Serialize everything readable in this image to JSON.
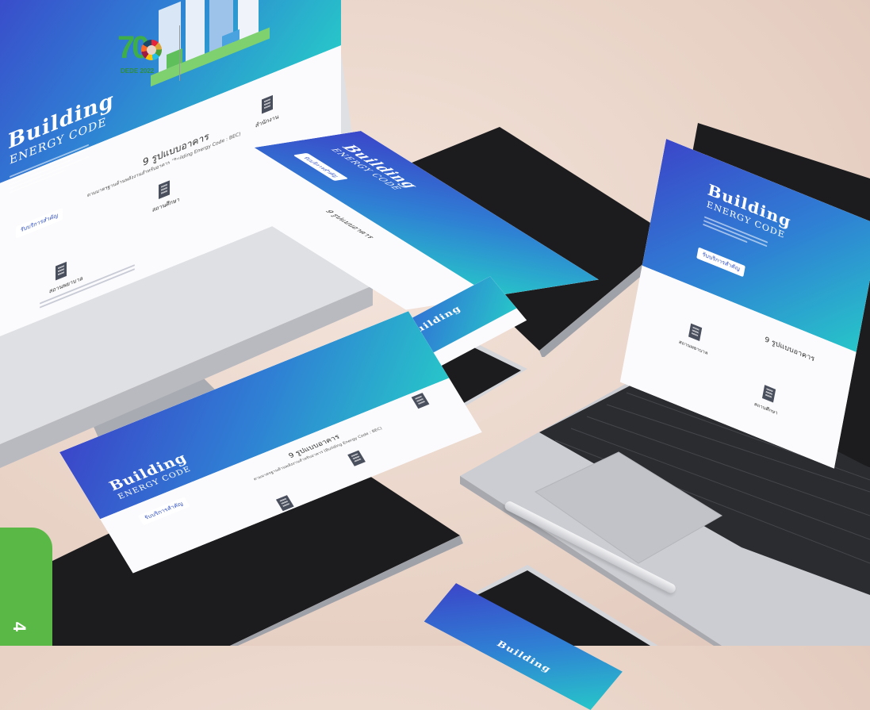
{
  "badge": {
    "page_number": "4",
    "color": "#5ab946"
  },
  "logo": {
    "number": "70",
    "caption": "DEDE 2022",
    "icon": "anniversary-logo"
  },
  "site": {
    "title_main": "Building",
    "title_sub": "ENERGY CODE",
    "cta_label": "รับบริการสำคัญ",
    "section_title": "9 รูปแบบอาคาร",
    "section_subtitle": "ตามมาตรฐานด้านพลังงานสำหรับอาคาร (Building Energy Code : BEC)",
    "category_office": "สำนักงาน",
    "category_education": "สถานศึกษา",
    "category_hospital": "สถานพยาบาล"
  },
  "colors": {
    "hero_start": "#3b46c9",
    "hero_end": "#27c5c9",
    "background": "#ecd9cf",
    "device_frame": "#1c1c1f",
    "aluminum": "#c9cacf"
  }
}
